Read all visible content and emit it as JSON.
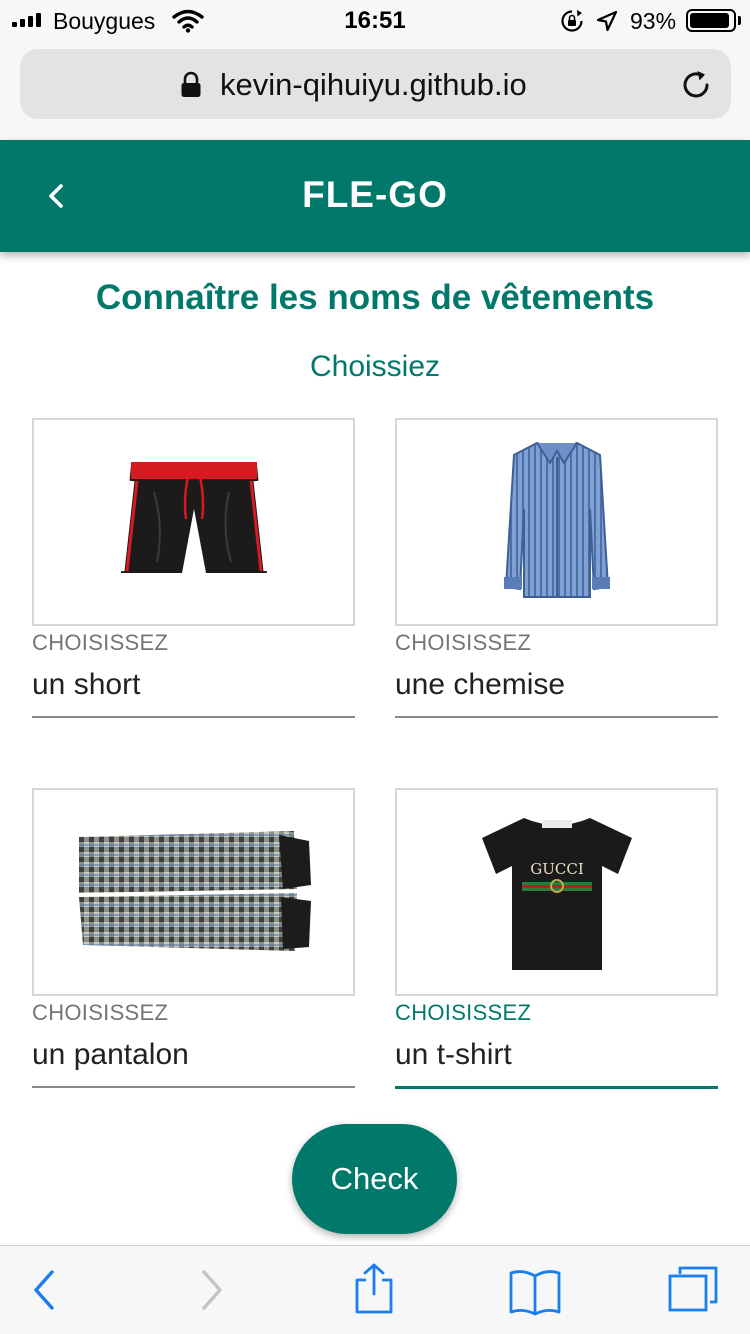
{
  "status_bar": {
    "carrier": "Bouygues",
    "time": "16:51",
    "battery_percent": "93%",
    "battery_level": 0.93
  },
  "browser": {
    "url": "kevin-qihuiyu.github.io"
  },
  "app": {
    "title": "FLE-GO"
  },
  "page": {
    "title": "Connaître les noms de vêtements",
    "subtitle": "Choissiez"
  },
  "cards": [
    {
      "label": "CHOISISSEZ",
      "value": "un short",
      "image_icon": "shorts-image"
    },
    {
      "label": "CHOISISSEZ",
      "value": "une chemise",
      "image_icon": "shirt-image"
    },
    {
      "label": "CHOISISSEZ",
      "value": "un pantalon",
      "image_icon": "trousers-image"
    },
    {
      "label": "CHOISISSEZ",
      "value": "un t-shirt",
      "image_icon": "tshirt-image",
      "logo_text": "GUCCI"
    }
  ],
  "actions": {
    "check_label": "Check"
  },
  "colors": {
    "primary": "#00796b",
    "ios_blue": "#1a7ef0"
  }
}
